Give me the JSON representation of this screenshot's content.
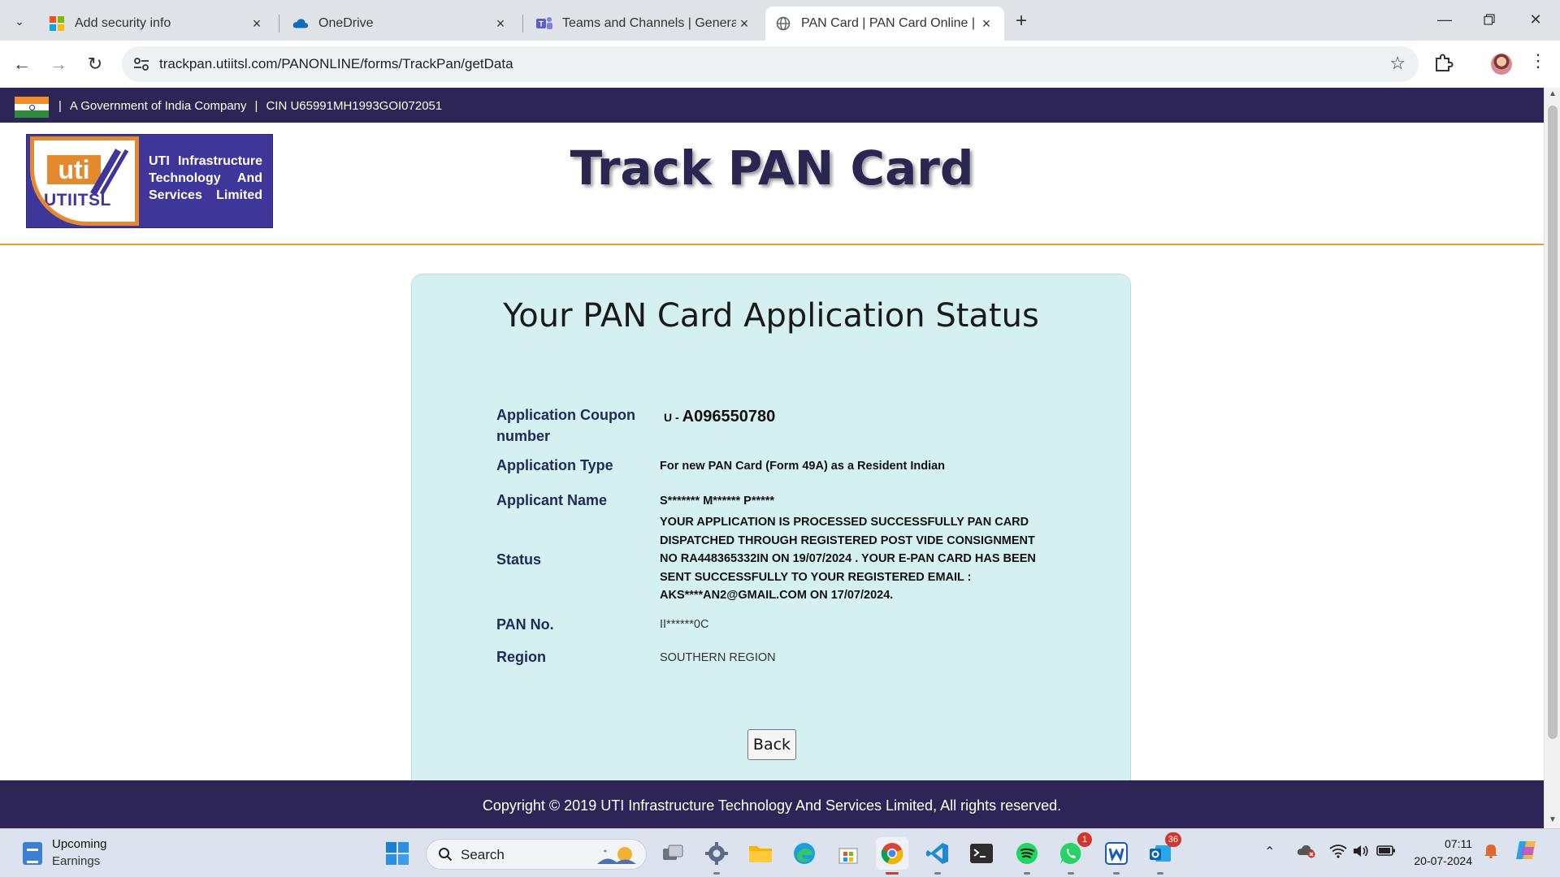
{
  "browser": {
    "tabs": [
      {
        "title": "Add security info",
        "icon": "microsoft-logo-icon",
        "active": false
      },
      {
        "title": "OneDrive",
        "icon": "onedrive-cloud-icon",
        "active": false
      },
      {
        "title": "Teams and Channels | General |",
        "icon": "teams-icon",
        "active": false
      },
      {
        "title": "PAN Card | PAN Card Online | P",
        "icon": "globe-icon",
        "active": true
      }
    ],
    "url": "trackpan.utiitsl.com/PANONLINE/forms/TrackPan/getData"
  },
  "gov_bar": {
    "company_line": "A Government of India Company",
    "cin": "CIN U65991MH1993GOI072051",
    "separator": "|"
  },
  "header": {
    "logo_mark": "uti",
    "logo_name": "UTIITSL",
    "logo_description": "UTI Infrastructure Technology And Services Limited",
    "title": "Track PAN Card"
  },
  "status_card": {
    "heading": "Your PAN Card Application Status",
    "rows": [
      {
        "label": "Application Coupon number",
        "prefix": "U -",
        "value": "A096550780"
      },
      {
        "label": "Application Type",
        "value": "For new PAN Card (Form 49A) as a Resident Indian"
      },
      {
        "label": "Applicant Name",
        "value": "S******* M****** P*****"
      },
      {
        "label": "Status",
        "value": "YOUR APPLICATION IS PROCESSED SUCCESSFULLY PAN CARD DISPATCHED THROUGH REGISTERED POST VIDE CONSIGNMENT NO RA448365332IN ON 19/07/2024 . YOUR E-PAN CARD HAS BEEN SENT SUCCESSFULLY TO YOUR REGISTERED EMAIL : AKS****AN2@GMAIL.COM ON 17/07/2024."
      },
      {
        "label": "PAN No.",
        "value": "II******0C"
      },
      {
        "label": "Region",
        "value": "SOUTHERN REGION"
      }
    ],
    "back_label": "Back"
  },
  "footer": {
    "copyright": "Copyright © 2019 UTI Infrastructure Technology And Services Limited, All rights reserved."
  },
  "taskbar": {
    "widget_title": "Upcoming",
    "widget_subtitle": "Earnings",
    "search_placeholder": "Search",
    "whatsapp_badge": "1",
    "outlook_badge": "36",
    "time": "07:11",
    "date": "20-07-2024"
  },
  "colors": {
    "nav_bar": "#2c2556",
    "card_bg": "#d5f0f1",
    "accent_orange": "#e29a3c",
    "logo_blue": "#3e3699"
  }
}
